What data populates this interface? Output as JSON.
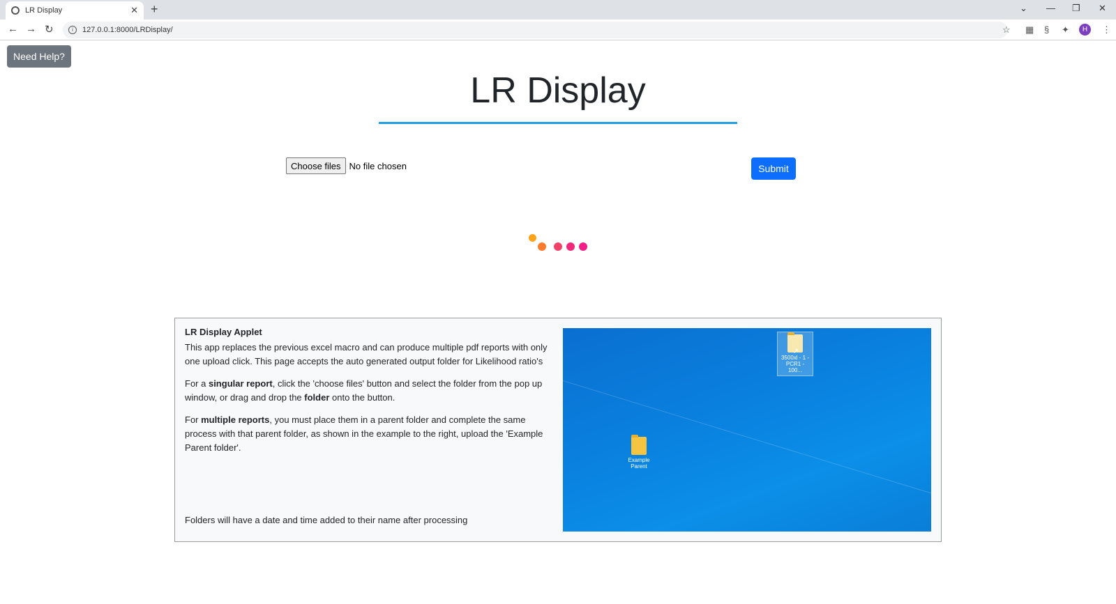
{
  "browser": {
    "tab_title": "LR Display",
    "url": "127.0.0.1:8000/LRDisplay/",
    "profile_initial": "H"
  },
  "page": {
    "help_button": "Need Help?",
    "title": "LR Display",
    "choose_files_label": "Choose files",
    "file_status": "No file chosen",
    "submit_label": "Submit",
    "loader_colors": [
      "#ffa21a",
      "#ff7a2a",
      "#f0436a",
      "#f0287a",
      "#f01e86"
    ]
  },
  "info": {
    "heading": "LR Display Applet",
    "para1": "This app replaces the previous excel macro and can produce multiple pdf reports with only one upload click. This page accepts the auto generated output folder for Likelihood ratio's",
    "para2_pre": "For a ",
    "para2_bold1": "singular report",
    "para2_mid": ", click the 'choose files' button and select the folder from the pop up window, or drag and drop the ",
    "para2_bold2": "folder",
    "para2_post": " onto the button.",
    "para3_pre": "For ",
    "para3_bold": "multiple reports",
    "para3_post": ", you must place them in a parent folder and complete the same process with that parent folder, as shown in the example to the right, upload the 'Example Parent folder'.",
    "footer": "Folders will have a date and time added to their name after processing"
  },
  "desktop_image": {
    "folder1_label": "3500xl - 1 - PCR1 - 100...",
    "folder2_label": "Example Parent"
  }
}
